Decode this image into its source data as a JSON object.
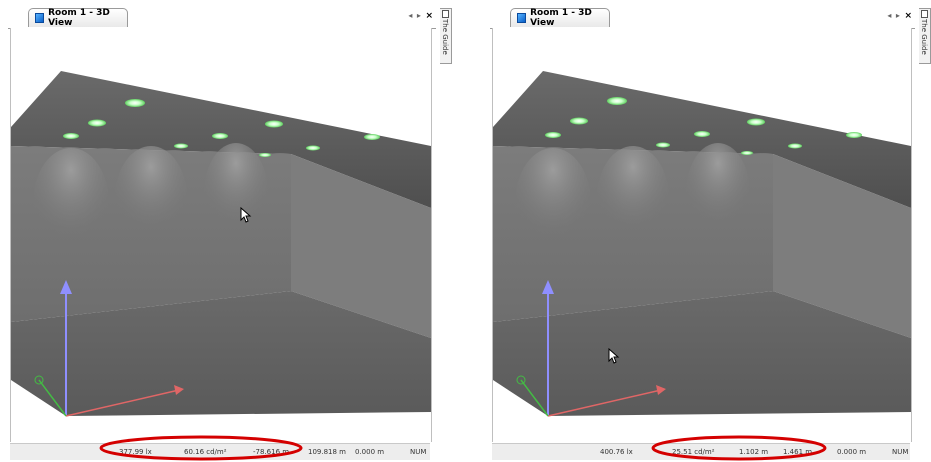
{
  "left": {
    "tab_title": "Room 1 - 3D View",
    "tab_controls": "◂ ▸",
    "close_glyph": "×",
    "guide_label": "The Guide",
    "status": {
      "illuminance": "377.99 lx",
      "luminance": "60.16 cd/m²",
      "x": "-78.616 m",
      "y": "109.818 m",
      "z": "0.000 m",
      "mode": "NUM"
    }
  },
  "right": {
    "tab_title": "Room 1 - 3D View",
    "tab_controls": "◂ ▸",
    "close_glyph": "×",
    "guide_label": "The Guide",
    "status": {
      "illuminance": "400.76 lx",
      "luminance": "25.51 cd/m²",
      "x": "1.102 m",
      "y": "1.461 m",
      "z": "0.000 m",
      "mode": "NUM"
    }
  },
  "colors": {
    "highlight_ellipse": "#d40000",
    "light_glow": "#7bff7b",
    "axis_up": "#8f8fff",
    "axis_x": "#e06666",
    "axis_z": "#44bb44"
  }
}
